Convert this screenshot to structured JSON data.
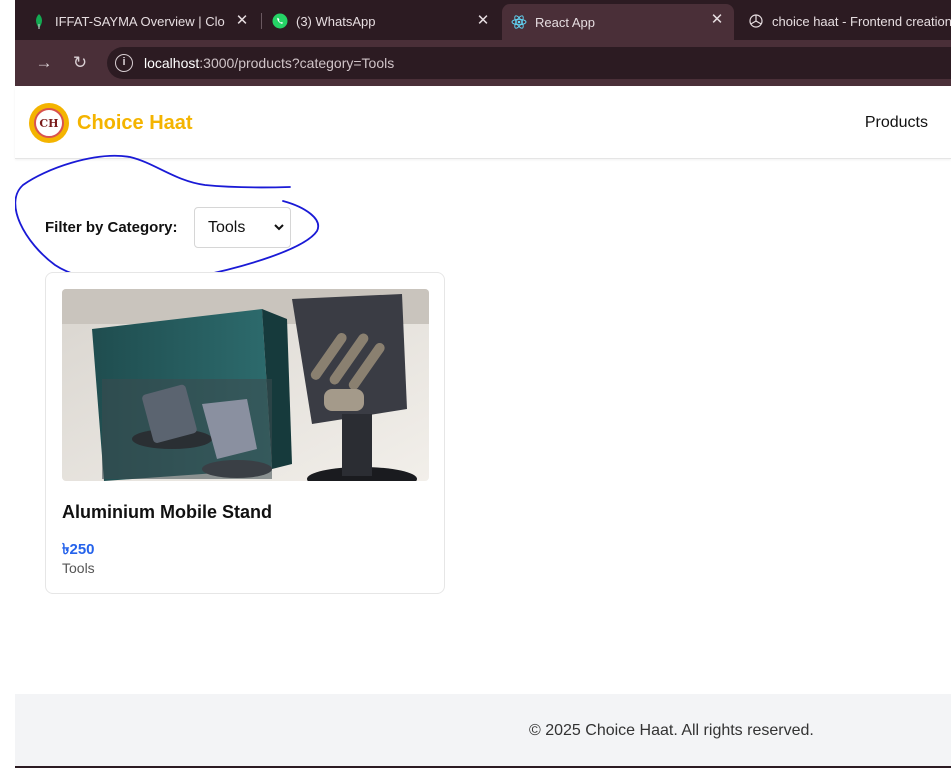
{
  "browser": {
    "tabs": [
      {
        "title": "IFFAT-SAYMA Overview | Cloud",
        "icon": "leaf-icon",
        "active": false
      },
      {
        "title": "(3) WhatsApp",
        "icon": "whatsapp-icon",
        "active": false
      },
      {
        "title": "React App",
        "icon": "react-icon",
        "active": true
      },
      {
        "title": "choice haat - Frontend creation",
        "icon": "chatgpt-icon",
        "active": false
      }
    ],
    "close_glyph": "✕",
    "url_host": "localhost",
    "url_rest": ":3000/products?category=Tools",
    "info_glyph": "i"
  },
  "navbar": {
    "brand": "Choice Haat",
    "logo_text": "CH",
    "links": [
      "Products"
    ]
  },
  "filter": {
    "label": "Filter by Category:",
    "selected": "Tools"
  },
  "products": [
    {
      "name": "Aluminium Mobile Stand",
      "price": "৳250",
      "category": "Tools"
    }
  ],
  "footer": {
    "text": "© 2025 Choice Haat. All rights reserved."
  },
  "colors": {
    "brand": "#f4b400",
    "price": "#2563eb",
    "annotation": "#1a1ad6",
    "chrome_dark": "#2c1b22",
    "chrome_mid": "#4a2f38"
  }
}
